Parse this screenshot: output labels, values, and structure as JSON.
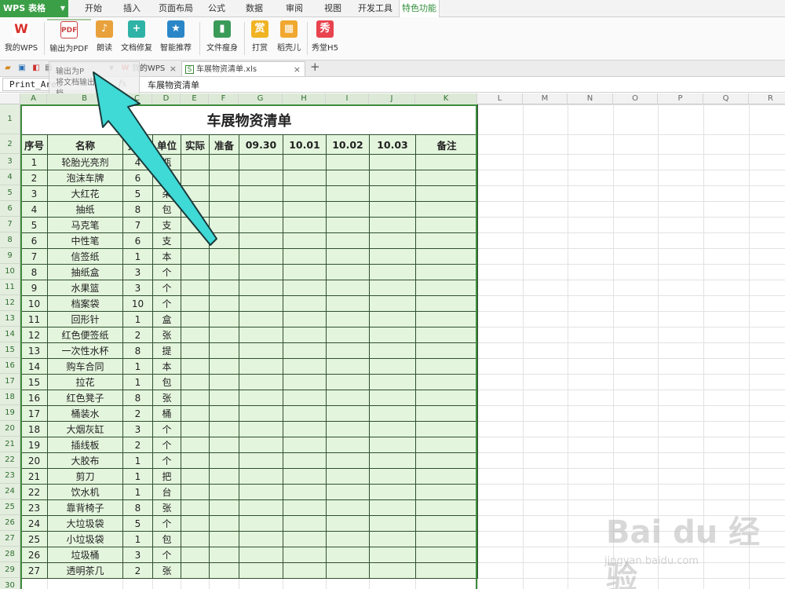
{
  "app": {
    "name": "WPS 表格"
  },
  "menu": {
    "tabs": [
      "开始",
      "插入",
      "页面布局",
      "公式",
      "数据",
      "审阅",
      "视图",
      "开发工具",
      "特色功能"
    ],
    "active": "特色功能"
  },
  "ribbon": {
    "buttons": [
      {
        "label": "我的WPS",
        "icon": "wps-logo-icon"
      },
      {
        "label": "输出为PDF",
        "icon": "pdf-export-icon"
      },
      {
        "label": "朗读",
        "icon": "read-aloud-icon"
      },
      {
        "label": "文档修复",
        "icon": "doc-repair-icon"
      },
      {
        "label": "智能推荐",
        "icon": "smart-recommend-icon"
      },
      {
        "label": "文件瘦身",
        "icon": "file-slim-icon"
      },
      {
        "label": "打赏",
        "icon": "reward-icon"
      },
      {
        "label": "稻壳儿",
        "icon": "docer-icon"
      },
      {
        "label": "秀堂H5",
        "icon": "h5-icon"
      }
    ]
  },
  "tooltip": {
    "line1": "输出为P",
    "line2": "将文档输出为",
    "line3": "档。"
  },
  "doc_tabs": [
    {
      "label": "我的WPS",
      "active": false
    },
    {
      "label": "车展物资清单.xls",
      "active": true
    }
  ],
  "formula_bar": {
    "name_box": "Print_Area",
    "fx": "fx",
    "content": "车展物资清单"
  },
  "columns": [
    "A",
    "B",
    "C",
    "D",
    "E",
    "F",
    "G",
    "H",
    "I",
    "J",
    "K",
    "L",
    "M",
    "N",
    "O",
    "P",
    "Q",
    "R"
  ],
  "sheet": {
    "title": "车展物资清单",
    "headers": [
      "序号",
      "名称",
      "数量",
      "单位",
      "实际",
      "准备",
      "09.30",
      "10.01",
      "10.02",
      "10.03",
      "备注"
    ],
    "rows": [
      [
        "1",
        "轮胎光亮剂",
        "4",
        "瓶"
      ],
      [
        "2",
        "泡沫车牌",
        "6",
        ""
      ],
      [
        "3",
        "大红花",
        "5",
        "朵"
      ],
      [
        "4",
        "抽纸",
        "8",
        "包"
      ],
      [
        "5",
        "马克笔",
        "7",
        "支"
      ],
      [
        "6",
        "中性笔",
        "6",
        "支"
      ],
      [
        "7",
        "信签纸",
        "1",
        "本"
      ],
      [
        "8",
        "抽纸盒",
        "3",
        "个"
      ],
      [
        "9",
        "水果篮",
        "3",
        "个"
      ],
      [
        "10",
        "档案袋",
        "10",
        "个"
      ],
      [
        "11",
        "回形针",
        "1",
        "盒"
      ],
      [
        "12",
        "红色便签纸",
        "2",
        "张"
      ],
      [
        "13",
        "一次性水杯",
        "8",
        "提"
      ],
      [
        "14",
        "购车合同",
        "1",
        "本"
      ],
      [
        "15",
        "拉花",
        "1",
        "包"
      ],
      [
        "16",
        "红色凳子",
        "8",
        "张"
      ],
      [
        "17",
        "桶装水",
        "2",
        "桶"
      ],
      [
        "18",
        "大烟灰缸",
        "3",
        "个"
      ],
      [
        "19",
        "插线板",
        "2",
        "个"
      ],
      [
        "20",
        "大胶布",
        "1",
        "个"
      ],
      [
        "21",
        "剪刀",
        "1",
        "把"
      ],
      [
        "22",
        "饮水机",
        "1",
        "台"
      ],
      [
        "23",
        "靠背椅子",
        "8",
        "张"
      ],
      [
        "24",
        "大垃圾袋",
        "5",
        "个"
      ],
      [
        "25",
        "小垃圾袋",
        "1",
        "包"
      ],
      [
        "26",
        "垃圾桶",
        "3",
        "个"
      ],
      [
        "27",
        "透明茶几",
        "2",
        "张"
      ]
    ]
  },
  "watermark": {
    "logo": "Bai du 经验",
    "url": "jingyan.baidu.com"
  }
}
